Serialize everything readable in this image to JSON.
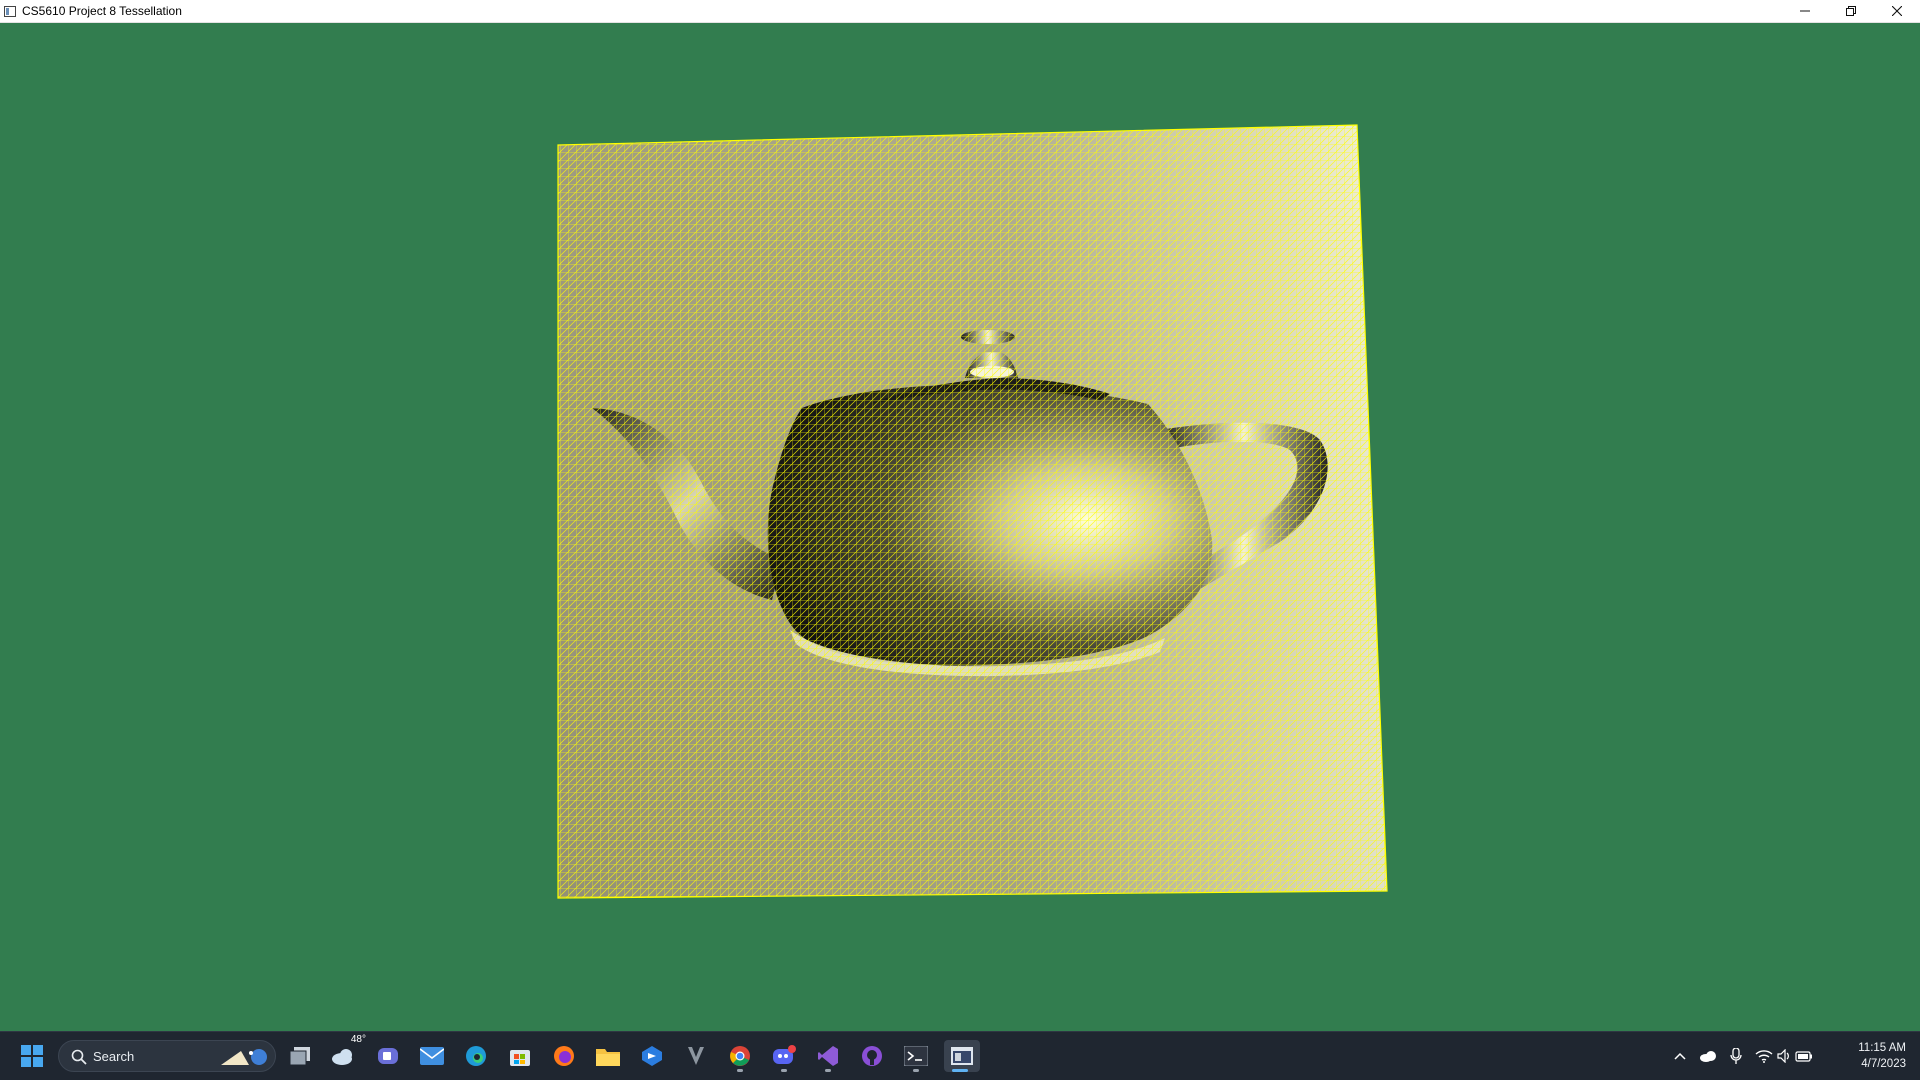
{
  "window": {
    "title": "CS5610 Project 8 Tessellation",
    "icon": "app-window-icon",
    "controls": [
      "minimize-icon",
      "restore-icon",
      "close-icon"
    ]
  },
  "scene": {
    "background_color": "#327d4f",
    "wireframe_color": "#ffff00",
    "subject": "teapot-normal-mapped-tessellated-plane"
  },
  "taskbar": {
    "search_placeholder": "Search",
    "weather_temp": "48°",
    "apps": [
      "start-icon",
      "search-icon",
      "task-view-icon",
      "weather-icon",
      "teams-chat-icon",
      "mail-icon",
      "edge-icon",
      "store-icon",
      "firefox-icon",
      "file-explorer-icon",
      "copilot-icon",
      "alienware-icon",
      "chrome-icon",
      "discord-icon",
      "visual-studio-icon",
      "github-desktop-icon",
      "terminal-icon",
      "opengl-app-icon"
    ],
    "tray_icons": [
      "chevron-up-icon",
      "onedrive-icon",
      "microphone-icon",
      "wifi-icon",
      "speaker-icon",
      "battery-icon"
    ],
    "time": "11:15 AM",
    "date": "4/7/2023"
  }
}
